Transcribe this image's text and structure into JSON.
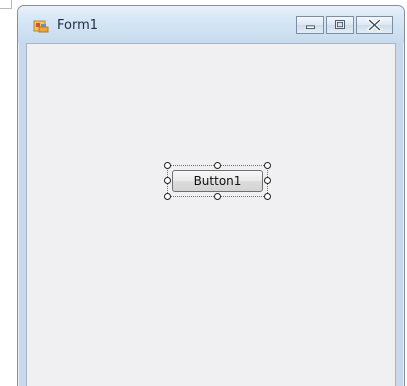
{
  "window": {
    "title": "Form1",
    "icon": "winforms-app-icon"
  },
  "caption_buttons": [
    {
      "name": "minimize",
      "icon": "minimize-icon"
    },
    {
      "name": "maximize",
      "icon": "maximize-icon"
    },
    {
      "name": "close",
      "icon": "close-icon"
    }
  ],
  "form": {
    "button_label": "Button1",
    "selection": "selected"
  },
  "colors": {
    "client_background": "#f0f0f3",
    "title_gradient": "#d7e7f6",
    "button_border": "#707070"
  }
}
